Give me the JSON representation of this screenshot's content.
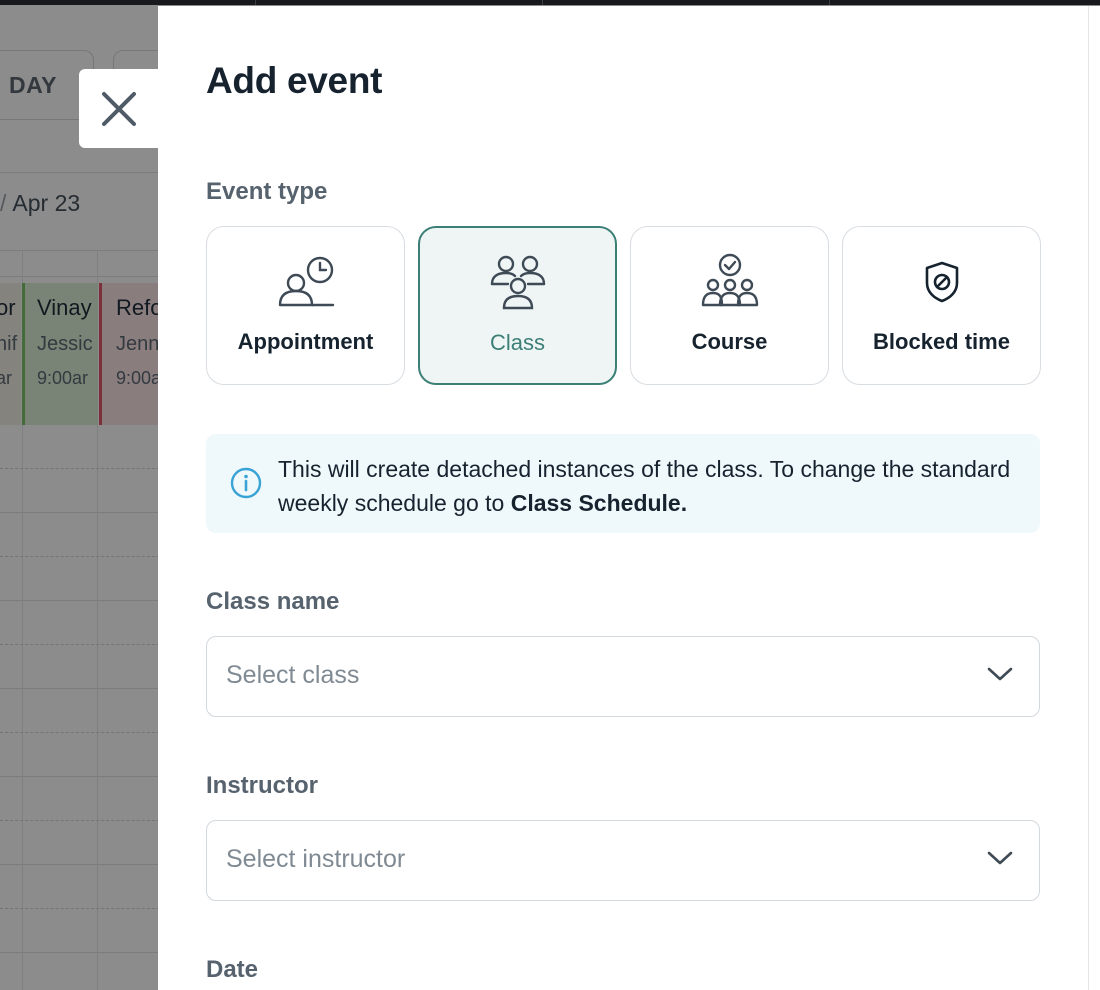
{
  "background": {
    "today_label": "DAY",
    "date_label": "Apr 23",
    "events": [
      {
        "title": "or",
        "subtitle": "nif",
        "time": "ar"
      },
      {
        "title": "Vinay",
        "subtitle": "Jessic",
        "time": "9:00ar"
      },
      {
        "title": "Refo",
        "subtitle": "Jenn",
        "time": "9:00a"
      }
    ]
  },
  "drawer": {
    "title": "Add event",
    "event_type": {
      "label": "Event type",
      "options": [
        {
          "label": "Appointment",
          "icon": "person-clock-icon",
          "selected": false
        },
        {
          "label": "Class",
          "icon": "group-icon",
          "selected": true
        },
        {
          "label": "Course",
          "icon": "group-check-icon",
          "selected": false
        },
        {
          "label": "Blocked time",
          "icon": "shield-blocked-icon",
          "selected": false
        }
      ]
    },
    "info": {
      "text": "This will create detached instances of the class. To change the standard weekly schedule go to ",
      "link": "Class Schedule."
    },
    "class_name": {
      "label": "Class name",
      "placeholder": "Select class"
    },
    "instructor": {
      "label": "Instructor",
      "placeholder": "Select instructor"
    },
    "date": {
      "label": "Date"
    }
  },
  "colors": {
    "accent": "#3c7f77",
    "accent_bg": "#eff5f5",
    "info_bg": "#eff8fb",
    "info_icon": "#3aa3d6",
    "text": "#16232f",
    "muted": "#56626d"
  }
}
